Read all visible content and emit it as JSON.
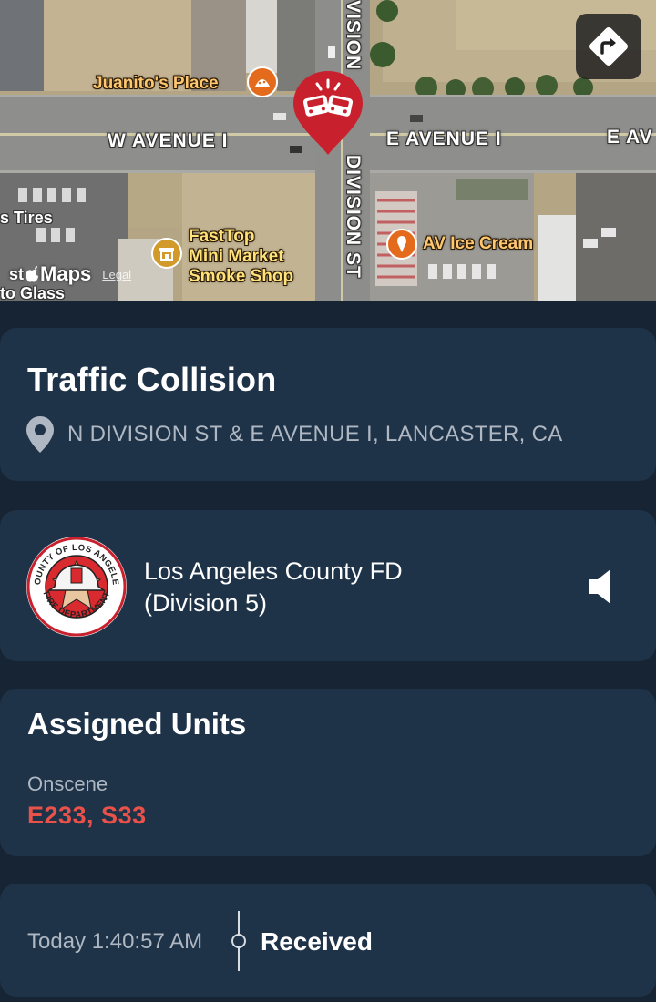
{
  "map": {
    "streets": {
      "w_avenue": "W AVENUE I",
      "e_avenue": "E AVENUE I",
      "e_avenue_edge": "E AV",
      "division_st": "DIVISION ST",
      "division_top": "VISION"
    },
    "pois": {
      "juanitos": "Juanito's Place",
      "fasttop": [
        "FastTop",
        "Mini Market",
        "Smoke Shop"
      ],
      "av_ice_cream": "AV Ice Cream",
      "tires": "s Tires",
      "glass": "to Glass",
      "st_prefix": "st"
    },
    "attribution": {
      "logo": "Maps",
      "legal": "Legal"
    },
    "icons": {
      "directions": "directions-icon",
      "incident_pin": "traffic-collision-pin-icon"
    }
  },
  "incident": {
    "title": "Traffic Collision",
    "address": "N DIVISION ST & E AVENUE I, LANCASTER, CA",
    "location_icon": "location-pin-icon"
  },
  "agency": {
    "name_line1": "Los Angeles County FD",
    "name_line2": "(Division 5)",
    "seal_text": {
      "top": "COUNTY OF LOS ANGELES",
      "bottom": "FIRE DEPARTMENT"
    },
    "audio_icon": "speaker-icon"
  },
  "units": {
    "title": "Assigned Units",
    "status_label": "Onscene",
    "unit_list": "E233, S33"
  },
  "timeline": {
    "time": "Today 1:40:57 AM",
    "status": "Received"
  },
  "colors": {
    "background": "#162433",
    "card": "#1e3248",
    "secondary_text": "#aeb7c2",
    "unit_red": "#e8524a",
    "pin_red": "#c8202c"
  }
}
